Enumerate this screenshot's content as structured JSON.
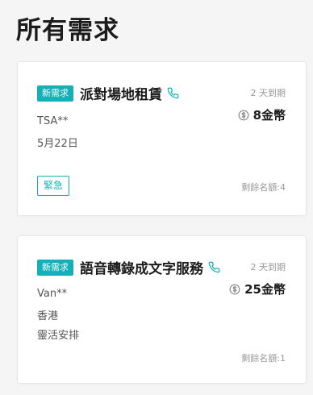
{
  "header": {
    "title": "所有需求"
  },
  "colors": {
    "accent": "#13b1b7",
    "muted": "#9a9a9a"
  },
  "requests": [
    {
      "badge": "新需求",
      "title": "派對場地租賃",
      "phone_icon": "phone-icon",
      "expiry": "2 天到期",
      "coin_icon": "coin-icon",
      "price": "8金幣",
      "info": [
        "TSA**",
        "5月22日"
      ],
      "tag": "緊急",
      "quota": "剩餘名額:4"
    },
    {
      "badge": "新需求",
      "title": "語音轉錄成文字服務",
      "phone_icon": "phone-icon",
      "expiry": "2 天到期",
      "coin_icon": "coin-icon",
      "price": "25金幣",
      "info": [
        "Van**",
        "香港",
        "靈活安排"
      ],
      "quota": "剩餘名額:1"
    }
  ]
}
